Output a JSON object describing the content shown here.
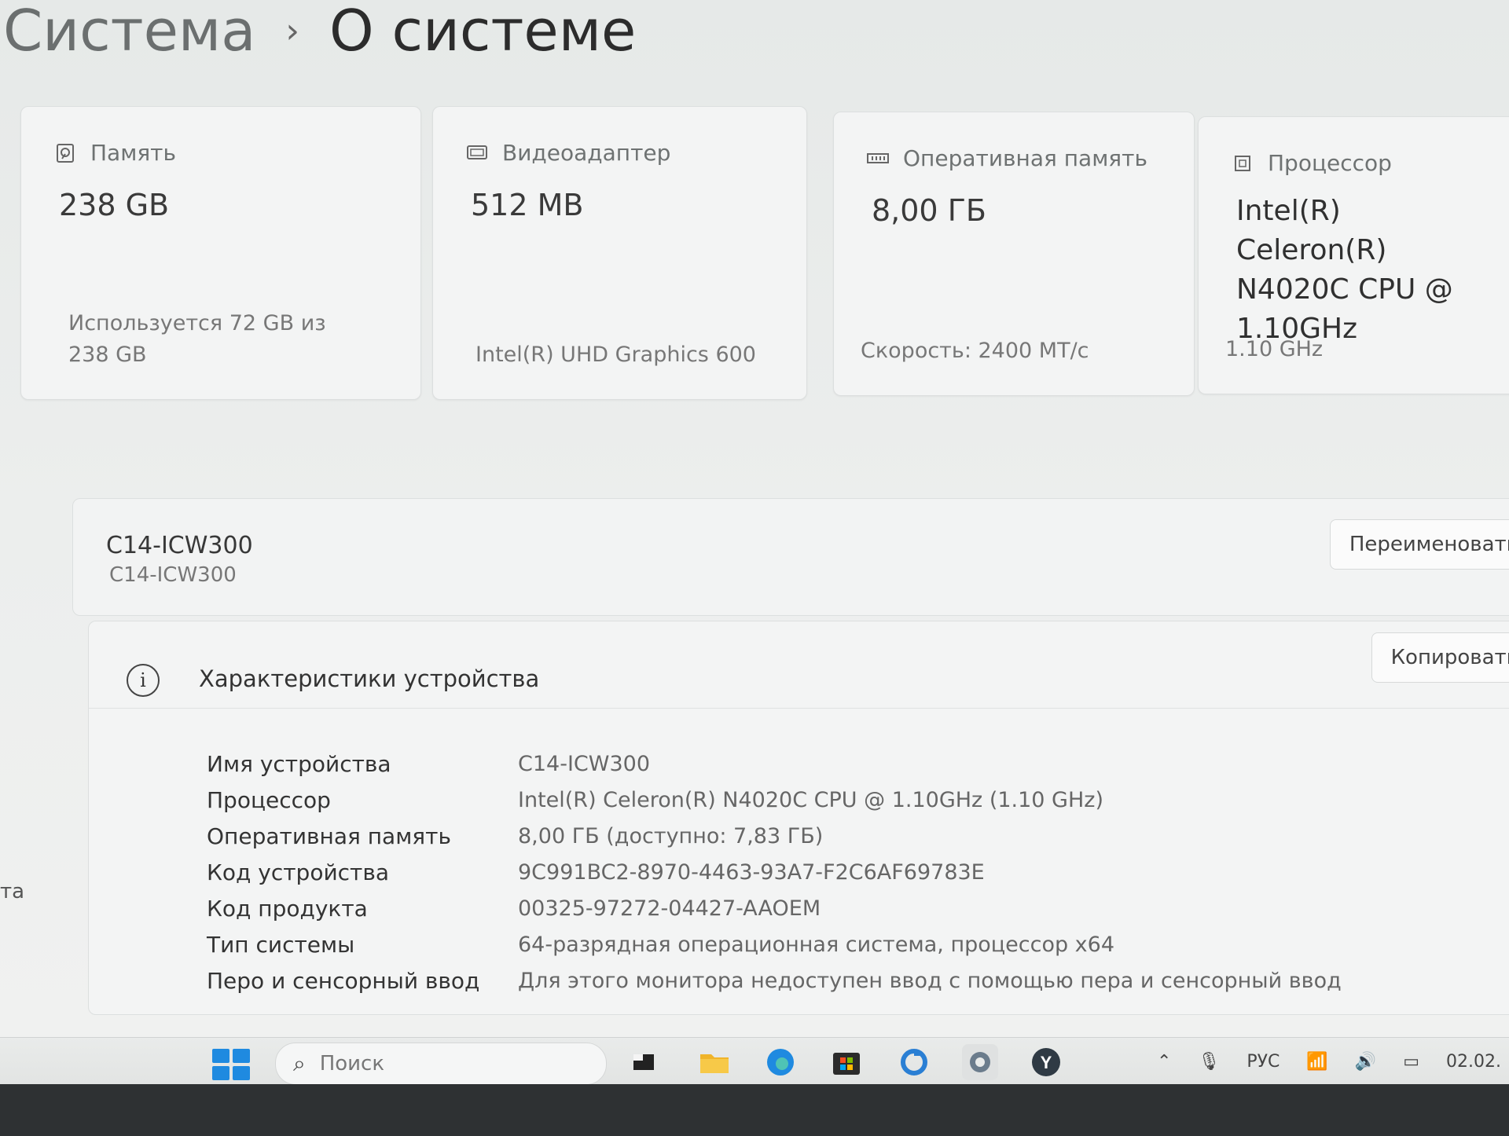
{
  "breadcrumb": {
    "root": "Система",
    "separator": "›",
    "current": "О системе"
  },
  "cards": {
    "storage": {
      "label": "Память",
      "value": "238 GB",
      "sub": "Используется 72 GB из 238 GB"
    },
    "gpu": {
      "label": "Видеоадаптер",
      "value": "512 MB",
      "sub": "Intel(R) UHD Graphics 600"
    },
    "ram": {
      "label": "Оперативная память",
      "value": "8,00 ГБ",
      "sub": "Скорость: 2400 MT/c"
    },
    "cpu": {
      "label": "Процессор",
      "value": "Intel(R) Celeron(R) N4020C CPU @ 1.10GHz",
      "sub": "1.10 GHz"
    }
  },
  "device": {
    "name": "C14-ICW300",
    "model": "C14-ICW300",
    "rename_label": "Переименовать"
  },
  "specs": {
    "title": "Характеристики устройства",
    "copy_label": "Копировать",
    "rows": [
      {
        "key": "Имя устройства",
        "value": "C14-ICW300"
      },
      {
        "key": "Процессор",
        "value": "Intel(R) Celeron(R) N4020C CPU @ 1.10GHz (1.10 GHz)"
      },
      {
        "key": "Оперативная память",
        "value": "8,00 ГБ (доступно: 7,83 ГБ)"
      },
      {
        "key": "Код устройства",
        "value": "9C991BC2-8970-4463-93A7-F2C6AF69783E"
      },
      {
        "key": "Код продукта",
        "value": "00325-97272-04427-AAOEM"
      },
      {
        "key": "Тип системы",
        "value": "64-разрядная операционная система, процессор x64"
      },
      {
        "key": "Перо и сенсорный ввод",
        "value": "Для этого монитора недоступен ввод с помощью пера и сенсорный ввод"
      }
    ]
  },
  "edge_text": "та",
  "taskbar": {
    "search_placeholder": "Поиск",
    "language": "РУС",
    "date": "02.02."
  },
  "colors": {
    "accent": "#1f8ae0",
    "page_bg": "#e9eceb",
    "card_bg": "#f3f4f4"
  }
}
